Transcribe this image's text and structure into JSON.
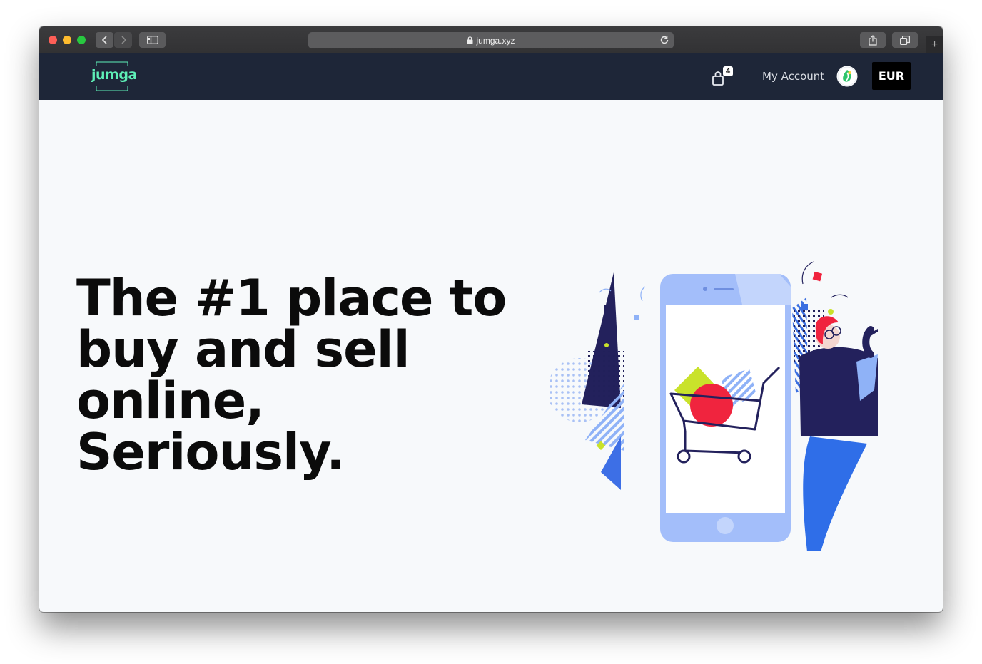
{
  "browser": {
    "url": "jumga.xyz",
    "new_tab_symbol": "+"
  },
  "navbar": {
    "logo_text": "jumga",
    "cart_count": "4",
    "my_account_label": "My Account",
    "currency_label": "EUR"
  },
  "hero": {
    "title_lines": [
      "The #1 place to",
      "buy and sell",
      "online,",
      "Seriously."
    ]
  },
  "icons": {
    "lock": "lock-icon",
    "reload": "reload-icon",
    "cart": "shopping-bag-icon",
    "avatar": "leaf-avatar-icon"
  },
  "colors": {
    "navbar_bg": "#1e2638",
    "logo_accent": "#5ef0b7",
    "page_bg": "#f7f9fb",
    "currency_bg": "#000000"
  }
}
